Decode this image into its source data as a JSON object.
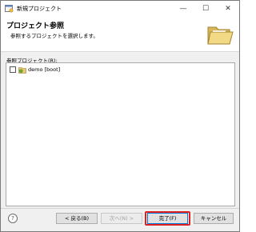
{
  "window": {
    "title": "新規プロジェクト"
  },
  "titlebar": {
    "minimize_glyph": "—",
    "maximize_glyph": "☐",
    "close_glyph": "✕"
  },
  "banner": {
    "title": "プロジェクト参照",
    "description": "参照するプロジェクトを選択します。",
    "icon": "folder-icon"
  },
  "references": {
    "label": "参照プロジェクト(R):",
    "items": [
      {
        "label": "demo [boot]",
        "checked": false,
        "icon": "project-icon"
      }
    ]
  },
  "footer": {
    "help_glyph": "?",
    "back_label": "< 戻る(B)",
    "next_label": "次へ(N) >",
    "finish_label": "完了(F)",
    "cancel_label": "キャンセル"
  },
  "colors": {
    "highlight": "#e0211d",
    "accent": "#0078d7"
  }
}
